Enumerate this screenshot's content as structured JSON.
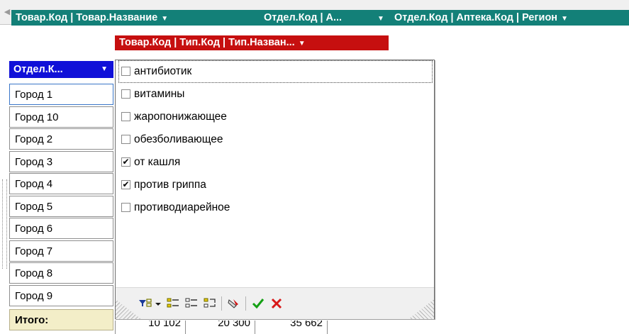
{
  "top_fields": [
    {
      "label": "Товар.Код | Товар.Название"
    },
    {
      "label": "Отдел.Код | А..."
    },
    {
      "label": "Отдел.Код | Аптека.Код | Регион"
    }
  ],
  "column_header": {
    "label": "Товар.Код | Тип.Код | Тип.Назван..."
  },
  "row_header": {
    "label": "Отдел.К..."
  },
  "rows": [
    "Город 1",
    "Город 10",
    "Город 2",
    "Город 3",
    "Город 4",
    "Город 5",
    "Город 6",
    "Город 7",
    "Город 8",
    "Город 9"
  ],
  "total_label": "Итого:",
  "totals": [
    "10 102",
    "20 300",
    "35 662"
  ],
  "filter_items": [
    {
      "label": "антибиотик",
      "checked": false
    },
    {
      "label": "витамины",
      "checked": false
    },
    {
      "label": "жаропонижающее",
      "checked": false
    },
    {
      "label": "обезболивающее",
      "checked": false
    },
    {
      "label": "от кашля",
      "checked": true
    },
    {
      "label": "против гриппа",
      "checked": true
    },
    {
      "label": "противодиарейное",
      "checked": false
    }
  ],
  "toolbar_icons": [
    "filter-options-icon",
    "select-all-icon",
    "deselect-all-icon",
    "invert-selection-icon",
    "clear-filter-icon",
    "ok-icon",
    "cancel-icon"
  ],
  "colors": {
    "top_bar": "#138078",
    "column_header": "#c60f0f",
    "row_header": "#1010d8",
    "ok": "#14a014",
    "cancel": "#d81818"
  }
}
